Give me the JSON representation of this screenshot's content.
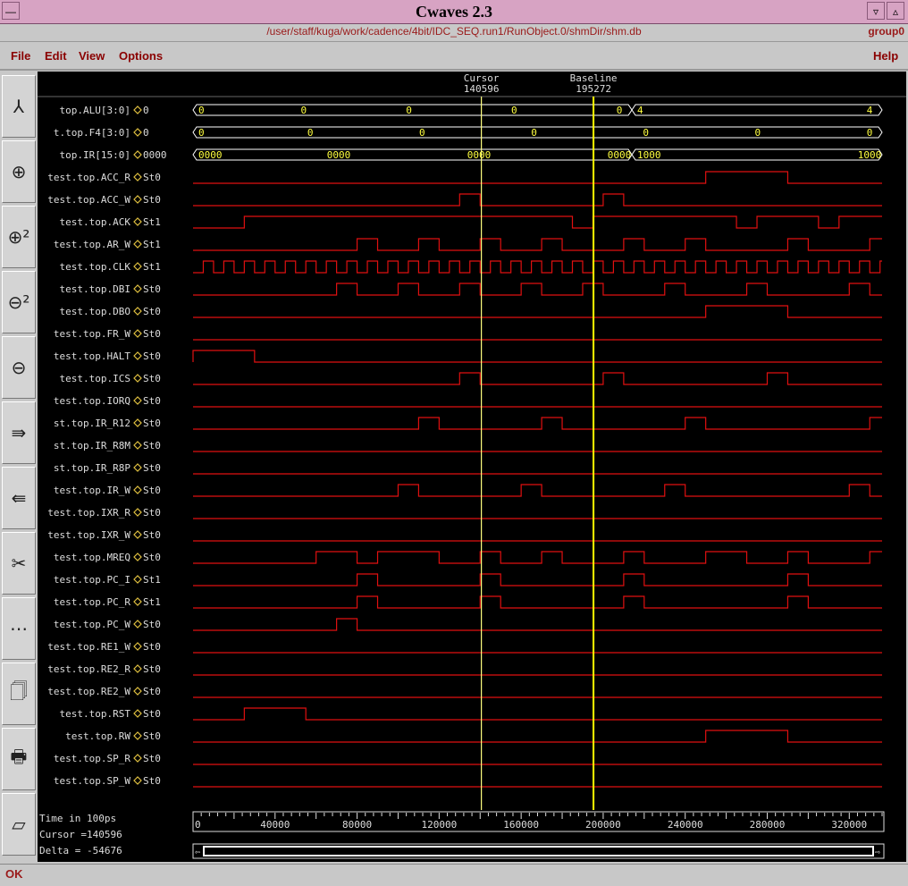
{
  "window": {
    "title": "Cwaves 2.3",
    "path": "/user/staff/kuga/work/cadence/4bit/IDC_SEQ.run1/RunObject.0/shmDir/shm.db",
    "group": "group0"
  },
  "menu": {
    "file": "File",
    "edit": "Edit",
    "view": "View",
    "options": "Options",
    "help": "Help"
  },
  "toolbar_icons": [
    "expand-icon",
    "zoom-fit-icon",
    "zoom-in-icon",
    "zoom-out-icon",
    "zoom-full-icon",
    "search-forward-icon",
    "search-backward-icon",
    "cut-icon",
    "paste-icon",
    "bottle-icon",
    "print-icon",
    "edit-icon"
  ],
  "header": {
    "cursor_label": "Cursor",
    "cursor_value": "140596",
    "baseline_label": "Baseline",
    "baseline_value": "195272"
  },
  "time": {
    "unit_label": "Time in 100ps",
    "cursor_text": "Cursor =140596",
    "delta_text": "Delta = -54676",
    "cursor": 140596,
    "baseline": 195272,
    "start": 0,
    "end": 336000,
    "ticks": [
      "40000",
      "80000",
      "120000",
      "160000",
      "200000",
      "240000",
      "280000",
      "320000"
    ],
    "tick_values": [
      40000,
      80000,
      120000,
      160000,
      200000,
      240000,
      280000,
      320000
    ]
  },
  "status": "OK",
  "signals": [
    {
      "name": "top.ALU[3:0]",
      "value": "0",
      "bus": true,
      "segments": [
        {
          "start": 0,
          "end": 214000,
          "labels": [
            "0",
            "0",
            "0",
            "0",
            "0"
          ]
        },
        {
          "start": 214000,
          "end": 336000,
          "labels": [
            "4",
            "4"
          ]
        }
      ]
    },
    {
      "name": "t.top.F4[3:0]",
      "value": "0",
      "bus": true,
      "segments": [
        {
          "start": 0,
          "end": 336000,
          "labels": [
            "0",
            "0",
            "0",
            "0",
            "0",
            "0",
            "0"
          ]
        }
      ]
    },
    {
      "name": "top.IR[15:0]",
      "value": "0000",
      "bus": true,
      "segments": [
        {
          "start": 0,
          "end": 214000,
          "labels": [
            "0000",
            "0000",
            "0000",
            "0000"
          ]
        },
        {
          "start": 214000,
          "end": 336000,
          "labels": [
            "1000",
            "1000"
          ]
        }
      ]
    },
    {
      "name": "test.top.ACC_R",
      "value": "St0",
      "init": 0,
      "edges": [
        250000,
        290000
      ]
    },
    {
      "name": "test.top.ACC_W",
      "value": "St0",
      "init": 0,
      "edges": [
        130000,
        140000,
        200000,
        210000
      ]
    },
    {
      "name": "test.top.ACK",
      "value": "St1",
      "init": 0,
      "edges": [
        25000,
        185000,
        195000,
        265000,
        275000,
        305000,
        315000
      ]
    },
    {
      "name": "test.top.AR_W",
      "value": "St1",
      "init": 0,
      "edges": [
        80000,
        90000,
        110000,
        120000,
        140000,
        150000,
        170000,
        180000,
        210000,
        220000,
        240000,
        250000,
        290000,
        300000,
        330000
      ]
    },
    {
      "name": "test.top.CLK",
      "value": "St1",
      "init": 0,
      "clock": true,
      "period": 10000
    },
    {
      "name": "test.top.DBI",
      "value": "St0",
      "init": 0,
      "edges": [
        70000,
        80000,
        100000,
        110000,
        130000,
        140000,
        160000,
        170000,
        190000,
        200000,
        230000,
        240000,
        270000,
        280000,
        320000,
        330000
      ]
    },
    {
      "name": "test.top.DBO",
      "value": "St0",
      "init": 0,
      "edges": [
        250000,
        290000
      ]
    },
    {
      "name": "test.top.FR_W",
      "value": "St0",
      "init": 0,
      "edges": []
    },
    {
      "name": "test.top.HALT",
      "value": "St0",
      "init": 1,
      "edges": [
        30000
      ]
    },
    {
      "name": "test.top.ICS",
      "value": "St0",
      "init": 0,
      "edges": [
        130000,
        140000,
        200000,
        210000,
        280000,
        290000
      ]
    },
    {
      "name": "test.top.IORQ",
      "value": "St0",
      "init": 0,
      "edges": []
    },
    {
      "name": "st.top.IR_R12",
      "value": "St0",
      "init": 0,
      "edges": [
        110000,
        120000,
        170000,
        180000,
        240000,
        250000,
        330000
      ]
    },
    {
      "name": "st.top.IR_R8M",
      "value": "St0",
      "init": 0,
      "edges": []
    },
    {
      "name": "st.top.IR_R8P",
      "value": "St0",
      "init": 0,
      "edges": []
    },
    {
      "name": "test.top.IR_W",
      "value": "St0",
      "init": 0,
      "edges": [
        100000,
        110000,
        160000,
        170000,
        230000,
        240000,
        320000,
        330000
      ]
    },
    {
      "name": "test.top.IXR_R",
      "value": "St0",
      "init": 0,
      "edges": []
    },
    {
      "name": "test.top.IXR_W",
      "value": "St0",
      "init": 0,
      "edges": []
    },
    {
      "name": "test.top.MREQ",
      "value": "St0",
      "init": 0,
      "edges": [
        60000,
        80000,
        90000,
        120000,
        140000,
        150000,
        170000,
        180000,
        210000,
        220000,
        250000,
        270000,
        290000,
        300000,
        330000
      ]
    },
    {
      "name": "test.top.PC_I",
      "value": "St1",
      "init": 0,
      "edges": [
        80000,
        90000,
        140000,
        150000,
        210000,
        220000,
        290000,
        300000
      ]
    },
    {
      "name": "test.top.PC_R",
      "value": "St1",
      "init": 0,
      "edges": [
        80000,
        90000,
        140000,
        150000,
        210000,
        220000,
        290000,
        300000
      ]
    },
    {
      "name": "test.top.PC_W",
      "value": "St0",
      "init": 0,
      "edges": [
        70000,
        80000
      ]
    },
    {
      "name": "test.top.RE1_W",
      "value": "St0",
      "init": 0,
      "edges": []
    },
    {
      "name": "test.top.RE2_R",
      "value": "St0",
      "init": 0,
      "edges": []
    },
    {
      "name": "test.top.RE2_W",
      "value": "St0",
      "init": 0,
      "edges": []
    },
    {
      "name": "test.top.RST",
      "value": "St0",
      "init": 0,
      "edges": [
        25000,
        55000
      ]
    },
    {
      "name": "test.top.RW",
      "value": "St0",
      "init": 0,
      "edges": [
        250000,
        290000
      ]
    },
    {
      "name": "test.top.SP_R",
      "value": "St0",
      "init": 0,
      "edges": []
    },
    {
      "name": "test.top.SP_W",
      "value": "St0",
      "init": 0,
      "edges": []
    }
  ]
}
